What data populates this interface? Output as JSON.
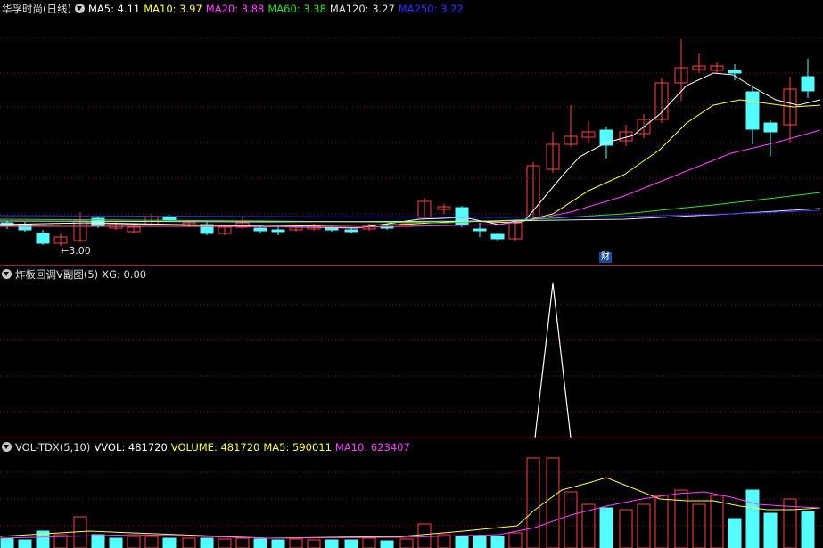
{
  "main": {
    "title": "华孚时尚(日线)",
    "ma": [
      {
        "label": "MA5: 4.11",
        "color": "#ffffff"
      },
      {
        "label": "MA10: 3.97",
        "color": "#ffff40"
      },
      {
        "label": "MA20: 3.88",
        "color": "#ff40ff"
      },
      {
        "label": "MA60: 3.38",
        "color": "#30e030"
      },
      {
        "label": "MA120: 3.27",
        "color": "#e0e0e0"
      },
      {
        "label": "MA250: 3.22",
        "color": "#3030ff"
      }
    ],
    "low_marker": "←3.00",
    "fin_badge": "财"
  },
  "sub1": {
    "title": "炸板回调V副图(5)",
    "xg": "XG: 0.00"
  },
  "vol": {
    "title": "VOL-TDX(5,10)",
    "fields": [
      {
        "label": "VVOL: 481720",
        "color": "#ffffff"
      },
      {
        "label": "VOLUME: 481720",
        "color": "#ffff40"
      },
      {
        "label": "MA5: 590011",
        "color": "#ffff40"
      },
      {
        "label": "MA10: 623407",
        "color": "#ff40ff"
      }
    ]
  },
  "colors": {
    "up": "#ff4040",
    "down": "#54ffff",
    "grid": "#8b1a1a",
    "sep": "#a02020"
  }
}
